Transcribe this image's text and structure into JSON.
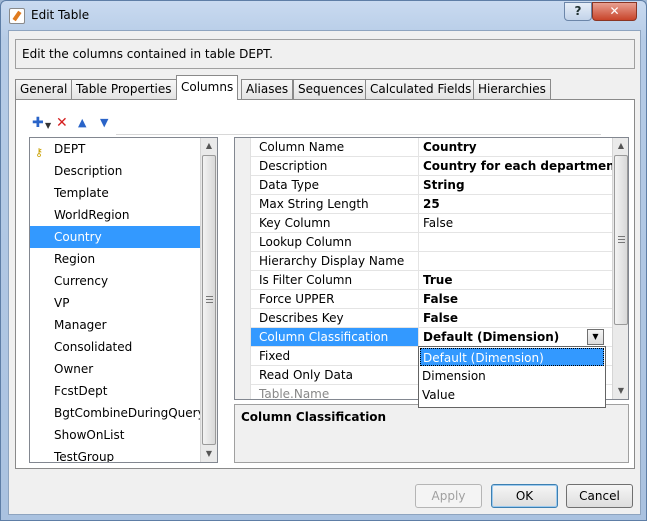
{
  "window": {
    "title": "Edit Table",
    "help_glyph": "?",
    "close_glyph": "✕"
  },
  "description": "Edit the columns contained in table DEPT.",
  "tabs": [
    {
      "label": "General",
      "active": false
    },
    {
      "label": "Table Properties",
      "active": false
    },
    {
      "label": "Columns",
      "active": true
    },
    {
      "label": "Aliases",
      "active": false
    },
    {
      "label": "Sequences",
      "active": false
    },
    {
      "label": "Calculated Fields",
      "active": false
    },
    {
      "label": "Hierarchies",
      "active": false
    }
  ],
  "toolbar": {
    "add_icon": "add-icon",
    "delete_icon": "delete-icon",
    "move_up_icon": "arrow-up-icon",
    "move_down_icon": "arrow-down-icon"
  },
  "columns_list": {
    "items": [
      {
        "label": "DEPT",
        "key": true
      },
      {
        "label": "Description"
      },
      {
        "label": "Template"
      },
      {
        "label": "WorldRegion"
      },
      {
        "label": "Country",
        "selected": true
      },
      {
        "label": "Region"
      },
      {
        "label": "Currency"
      },
      {
        "label": "VP"
      },
      {
        "label": "Manager"
      },
      {
        "label": "Consolidated"
      },
      {
        "label": "Owner"
      },
      {
        "label": "FcstDept"
      },
      {
        "label": "BgtCombineDuringQuery"
      },
      {
        "label": "ShowOnList"
      },
      {
        "label": "TestGroup"
      }
    ]
  },
  "properties": {
    "rows": [
      {
        "name": "Column Name",
        "value": "Country",
        "bold": true
      },
      {
        "name": "Description",
        "value": "Country for each departmen",
        "bold": true
      },
      {
        "name": "Data Type",
        "value": "String",
        "bold": true
      },
      {
        "name": "Max String Length",
        "value": "25",
        "bold": true
      },
      {
        "name": "Key Column",
        "value": "False",
        "bold": false
      },
      {
        "name": "Lookup Column",
        "value": "",
        "bold": false
      },
      {
        "name": "Hierarchy Display Name",
        "value": "",
        "bold": false
      },
      {
        "name": "Is Filter Column",
        "value": "True",
        "bold": true
      },
      {
        "name": "Force UPPER",
        "value": "False",
        "bold": true
      },
      {
        "name": "Describes Key",
        "value": "False",
        "bold": true
      },
      {
        "name": "Column Classification",
        "value": "Default (Dimension)",
        "bold": true,
        "selected": true
      },
      {
        "name": "Fixed",
        "value": "",
        "bold": false
      },
      {
        "name": "Read Only Data",
        "value": "",
        "bold": false
      },
      {
        "name": "Table.Name",
        "value": "",
        "bold": false,
        "dim": true
      }
    ]
  },
  "dropdown_options": [
    {
      "label": "Default (Dimension)",
      "selected": true
    },
    {
      "label": "Dimension"
    },
    {
      "label": "Value"
    }
  ],
  "help_panel": {
    "title": "Column Classification"
  },
  "buttons": {
    "apply": "Apply",
    "ok": "OK",
    "cancel": "Cancel"
  },
  "colors": {
    "selection": "#3399ff",
    "title_gradient": "#b5cbe6",
    "close_button": "#c8442a"
  }
}
